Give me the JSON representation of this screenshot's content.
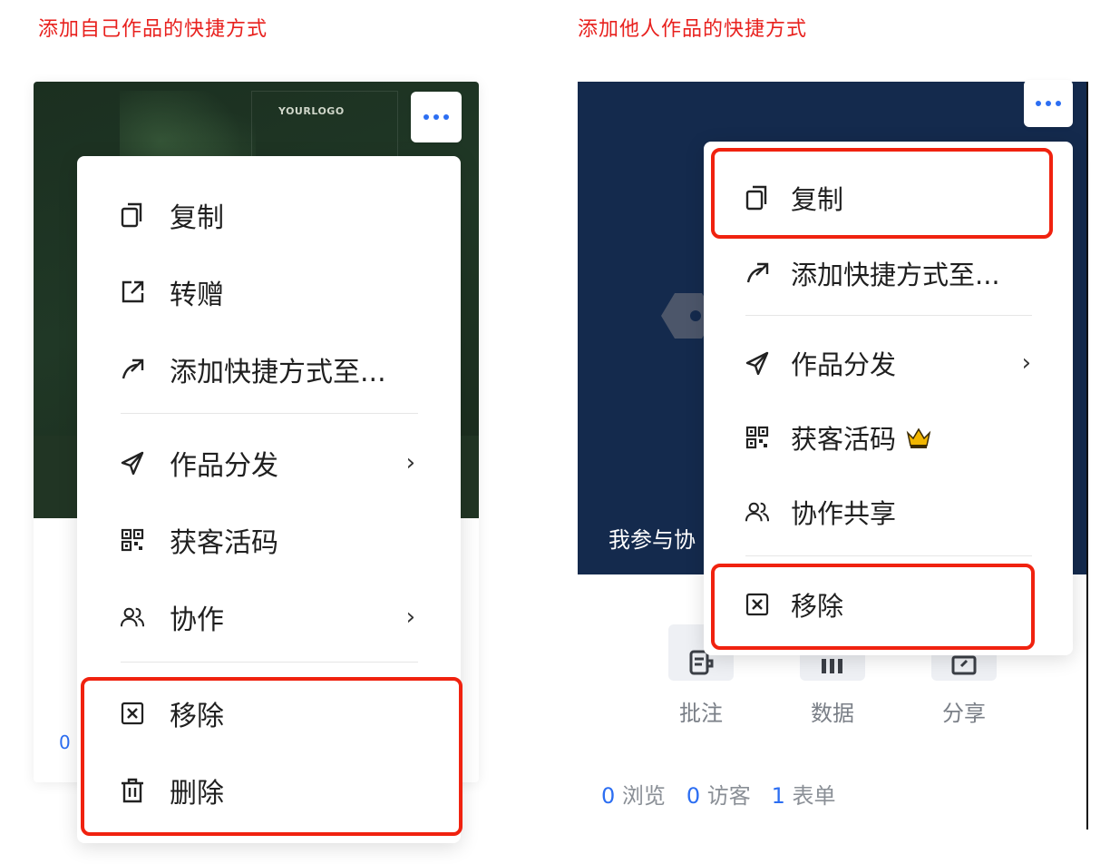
{
  "captions": {
    "left": "添加自己作品的快捷方式",
    "right": "添加他人作品的快捷方式"
  },
  "left_card": {
    "cover_logo_text": "YOURLOGO",
    "count_partial": "0",
    "menu": {
      "items": [
        {
          "label": "复制",
          "icon": "copy-icon"
        },
        {
          "label": "转赠",
          "icon": "transfer-icon"
        },
        {
          "label": "添加快捷方式至...",
          "icon": "shortcut-icon"
        },
        {
          "label": "作品分发",
          "icon": "send-icon",
          "has_submenu": true
        },
        {
          "label": "获客活码",
          "icon": "qr-code-icon"
        },
        {
          "label": "协作",
          "icon": "users-icon",
          "has_submenu": true
        },
        {
          "label": "移除",
          "icon": "remove-icon"
        },
        {
          "label": "删除",
          "icon": "trash-icon"
        }
      ],
      "chevron": "›"
    }
  },
  "right_card": {
    "cover_text": "我参与协",
    "menu": {
      "items": [
        {
          "label": "复制",
          "icon": "copy-icon"
        },
        {
          "label": "添加快捷方式至...",
          "icon": "shortcut-icon"
        },
        {
          "label": "作品分发",
          "icon": "send-icon",
          "has_submenu": true
        },
        {
          "label": "获客活码",
          "icon": "qr-code-icon",
          "badge_icon": "crown-icon"
        },
        {
          "label": "协作共享",
          "icon": "users-icon"
        },
        {
          "label": "移除",
          "icon": "remove-icon"
        }
      ],
      "chevron": "›"
    },
    "tools": [
      {
        "label": "批注",
        "icon": "annotate-icon"
      },
      {
        "label": "数据",
        "icon": "data-icon"
      },
      {
        "label": "分享",
        "icon": "share-icon"
      }
    ],
    "stats": {
      "views_value": "0",
      "views_label": "浏览",
      "visitors_value": "0",
      "visitors_label": "访客",
      "forms_value": "1",
      "forms_label": "表单"
    }
  },
  "colors": {
    "caption_red": "#e8211e",
    "highlight_red": "#f0220f",
    "accent_blue": "#2c6ef2"
  }
}
